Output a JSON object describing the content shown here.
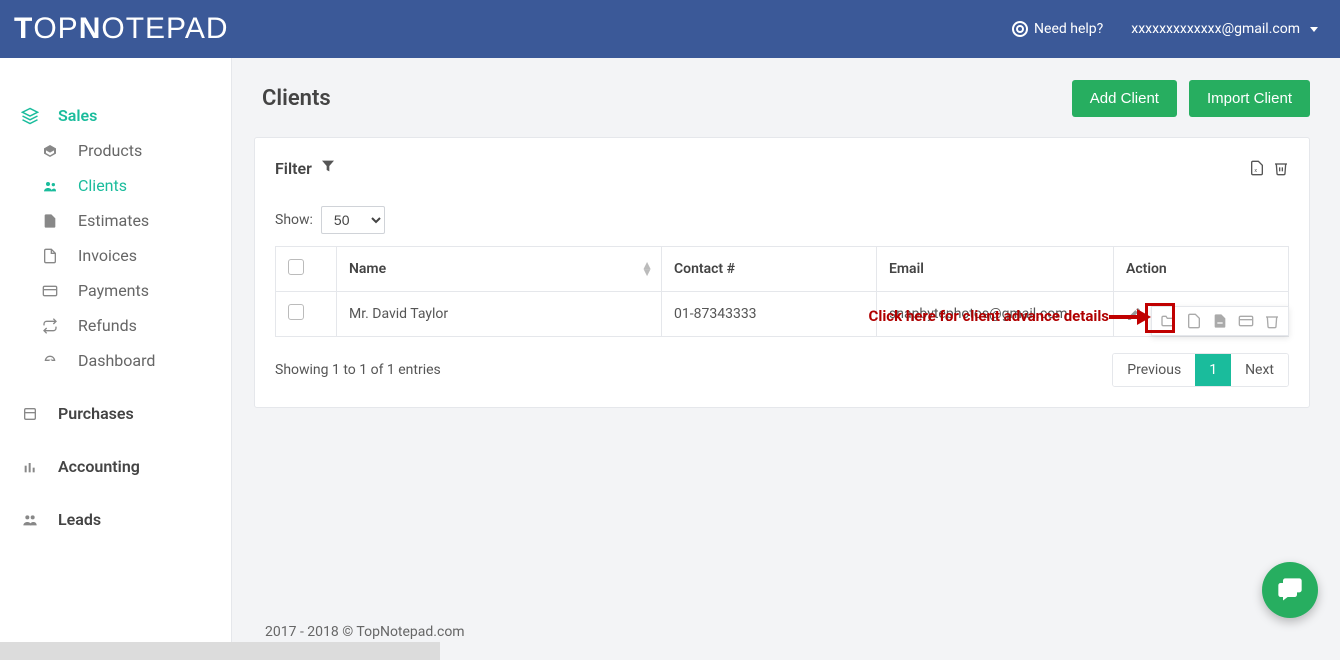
{
  "brand": "TopNotepad",
  "header": {
    "help": "Need help?",
    "user_email": "xxxxxxxxxxxxx@gmail.com"
  },
  "sidebar": {
    "sales": "Sales",
    "sales_items": [
      {
        "label": "Products",
        "icon": "cubes"
      },
      {
        "label": "Clients",
        "icon": "users",
        "active": true
      },
      {
        "label": "Estimates",
        "icon": "file"
      },
      {
        "label": "Invoices",
        "icon": "page"
      },
      {
        "label": "Payments",
        "icon": "card"
      },
      {
        "label": "Refunds",
        "icon": "swap"
      },
      {
        "label": "Dashboard",
        "icon": "gauge"
      }
    ],
    "purchases": "Purchases",
    "accounting": "Accounting",
    "leads": "Leads"
  },
  "page": {
    "title": "Clients",
    "add": "Add Client",
    "import": "Import Client"
  },
  "filter_label": "Filter",
  "show_label": "Show:",
  "show_value": "50",
  "columns": {
    "name": "Name",
    "contact": "Contact #",
    "email": "Email",
    "action": "Action"
  },
  "rows": [
    {
      "name": "Mr. David Taylor",
      "contact": "01-87343333",
      "email": "snapbytephotos@gmail.com"
    }
  ],
  "status": "Showing 1 to 1 of 1 entries",
  "pager": {
    "prev": "Previous",
    "page": "1",
    "next": "Next"
  },
  "annotation": "Click here for client advance details",
  "footer": "2017 - 2018 © TopNotepad.com"
}
